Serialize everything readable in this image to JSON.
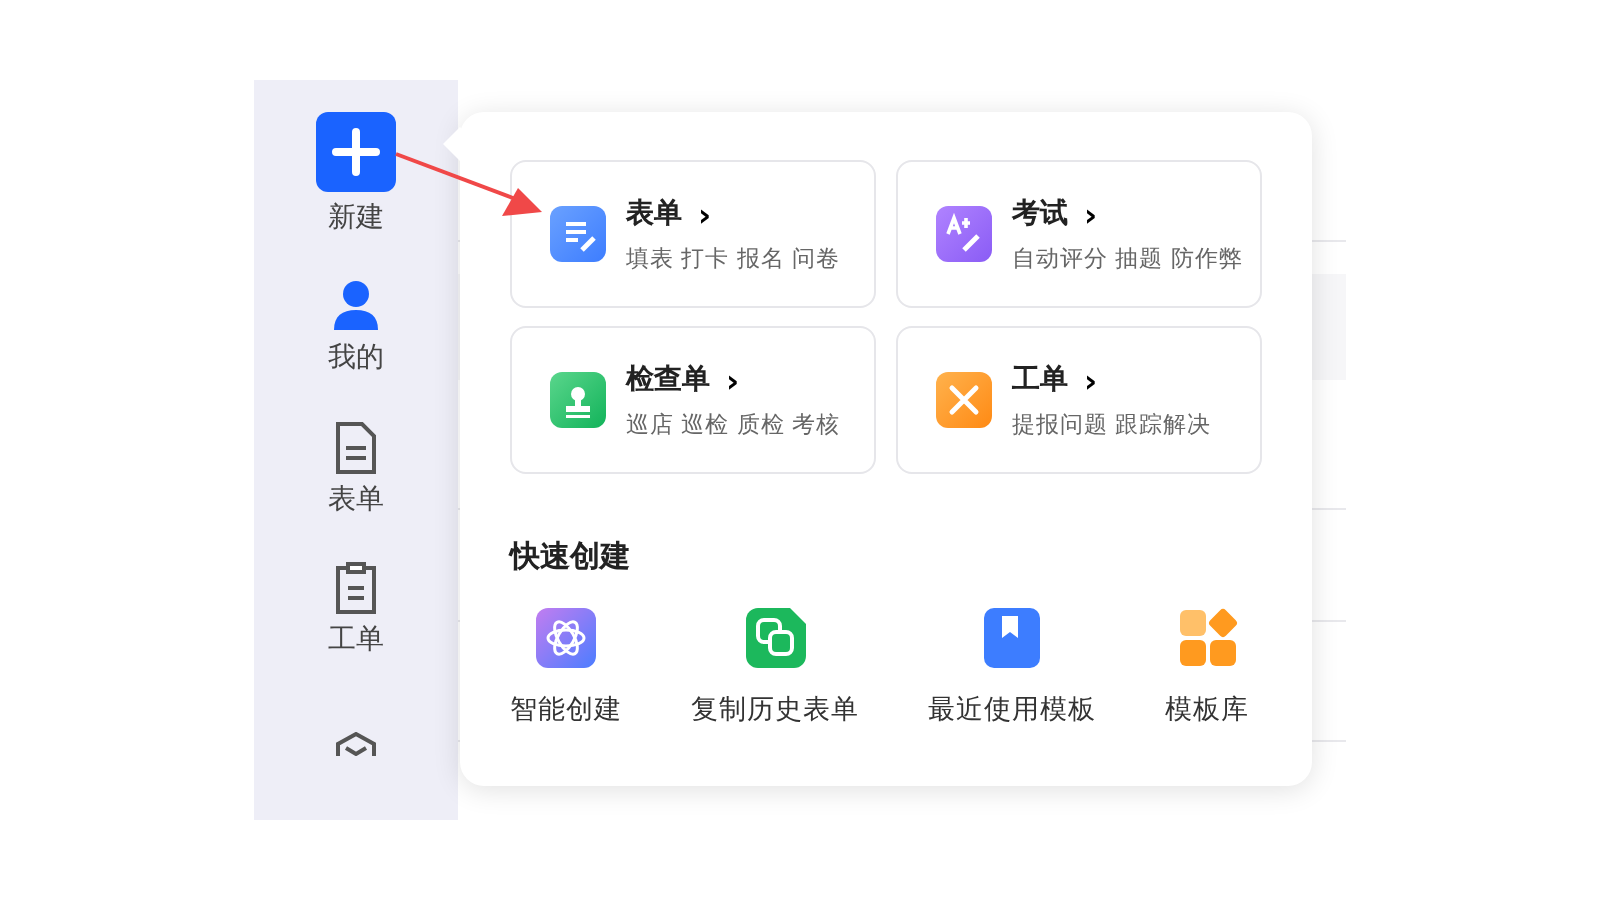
{
  "sidebar": {
    "items": [
      {
        "kind": "new",
        "label": "新建"
      },
      {
        "kind": "person",
        "label": "我的"
      },
      {
        "kind": "document",
        "label": "表单"
      },
      {
        "kind": "clipboard",
        "label": "工单"
      },
      {
        "kind": "cube"
      }
    ]
  },
  "popup": {
    "cards": [
      {
        "kind": "form",
        "title": "表单",
        "chevron": "›",
        "subtitle": "填表 打卡 报名 问卷"
      },
      {
        "kind": "exam",
        "title": "考试",
        "chevron": "›",
        "subtitle": "自动评分 抽题 防作弊"
      },
      {
        "kind": "checklist",
        "title": "检查单",
        "chevron": "›",
        "subtitle": "巡店 巡检 质检 考核"
      },
      {
        "kind": "ticket",
        "title": "工单",
        "chevron": "›",
        "subtitle": "提报问题 跟踪解决"
      }
    ],
    "quick_title": "快速创建",
    "quick_items": [
      {
        "kind": "ai",
        "label": "智能创建"
      },
      {
        "kind": "copy",
        "label": "复制历史表单"
      },
      {
        "kind": "recent",
        "label": "最近使用模板"
      },
      {
        "kind": "library",
        "label": "模板库"
      }
    ]
  }
}
